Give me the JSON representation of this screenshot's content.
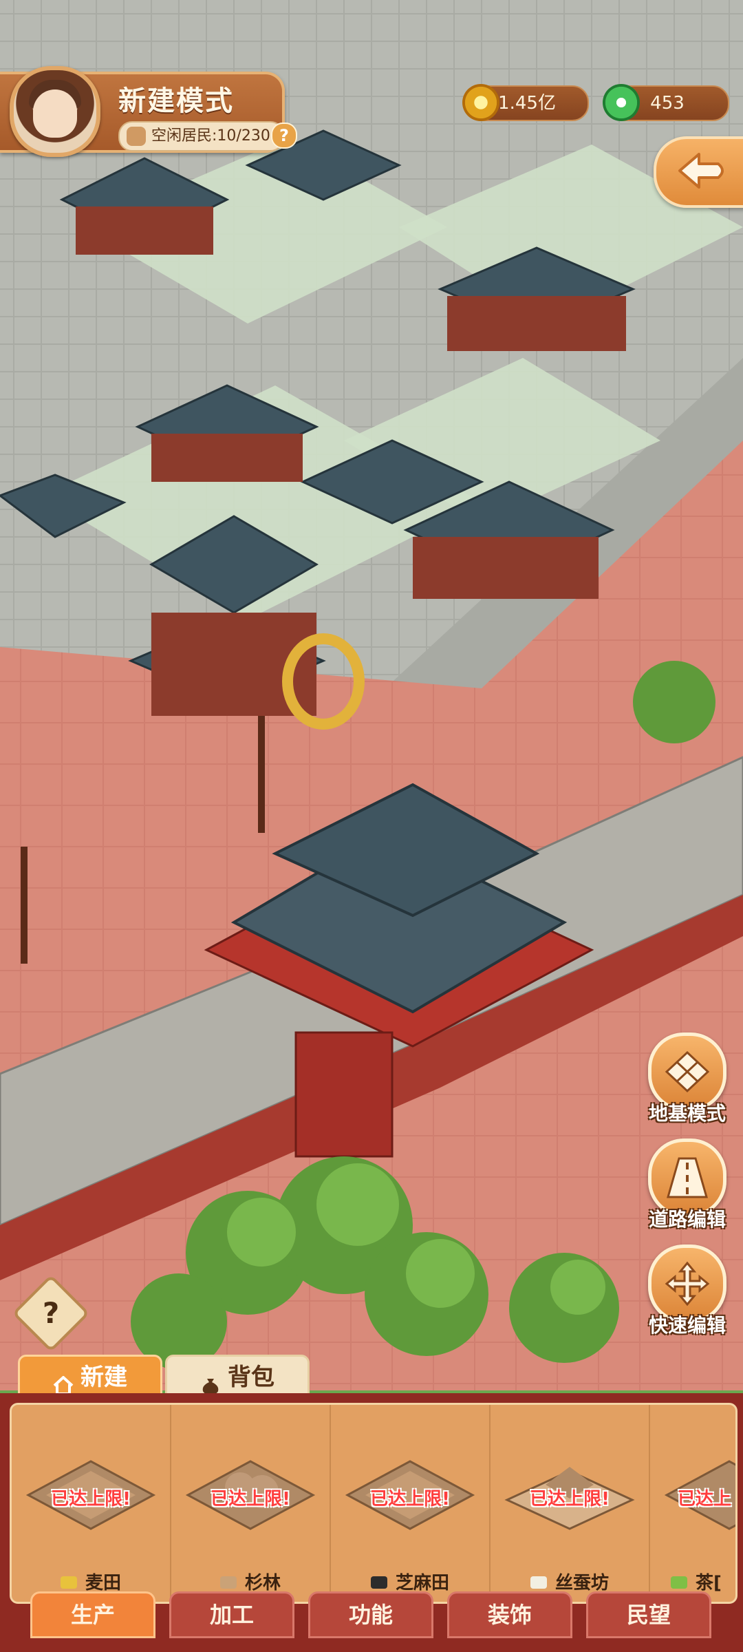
{
  "header": {
    "mode_title": "新建模式",
    "idle_residents_label": "空闲居民:10/230",
    "help_mark": "?"
  },
  "currencies": [
    {
      "icon": "gold-coin-icon",
      "value": "1.45亿"
    },
    {
      "icon": "jade-icon",
      "value": "453"
    }
  ],
  "tools": [
    {
      "label": "地基模式",
      "icon": "foundation-grid-icon"
    },
    {
      "label": "道路编辑",
      "icon": "road-icon"
    },
    {
      "label": "快速编辑",
      "icon": "move-arrows-icon"
    }
  ],
  "help_button": "?",
  "top_tabs": {
    "new": "新建",
    "bag": "背包"
  },
  "buildings": [
    {
      "status": "已达上限!",
      "name": "麦田",
      "icon": "wheat-icon"
    },
    {
      "status": "已达上限!",
      "name": "杉林",
      "icon": "log-icon"
    },
    {
      "status": "已达上限!",
      "name": "芝麻田",
      "icon": "sesame-icon"
    },
    {
      "status": "已达上限!",
      "name": "丝蚕坊",
      "icon": "cocoon-icon"
    },
    {
      "status": "已达上",
      "name": "茶[",
      "icon": "tea-icon"
    }
  ],
  "category_tabs": [
    "生产",
    "加工",
    "功能",
    "装饰",
    "民望"
  ],
  "active_category": "生产",
  "colors": {
    "accent": "#f2843a",
    "panel": "#8f2a22",
    "limit_text": "#ff3d3d"
  }
}
